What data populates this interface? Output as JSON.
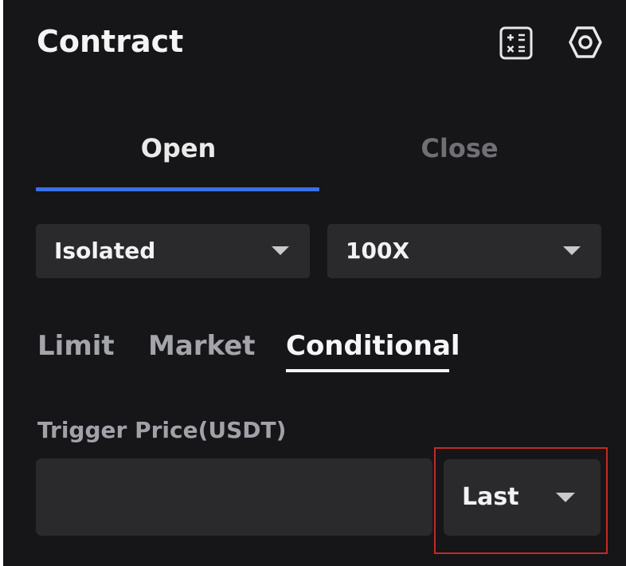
{
  "header": {
    "title": "Contract",
    "icons": [
      "calculator-icon",
      "settings-icon"
    ]
  },
  "position_tabs": {
    "open_label": "Open",
    "close_label": "Close",
    "active": "Open"
  },
  "margin_mode": {
    "selected": "Isolated"
  },
  "leverage": {
    "selected": "100X"
  },
  "order_types": {
    "limit_label": "Limit",
    "market_label": "Market",
    "conditional_label": "Conditional",
    "active": "Conditional"
  },
  "trigger": {
    "label": "Trigger Price(USDT)",
    "value": "",
    "price_type_selected": "Last"
  },
  "colors": {
    "background": "#161518",
    "surface": "#2a2a2d",
    "accent": "#3870e9",
    "highlight": "#c42a25"
  }
}
